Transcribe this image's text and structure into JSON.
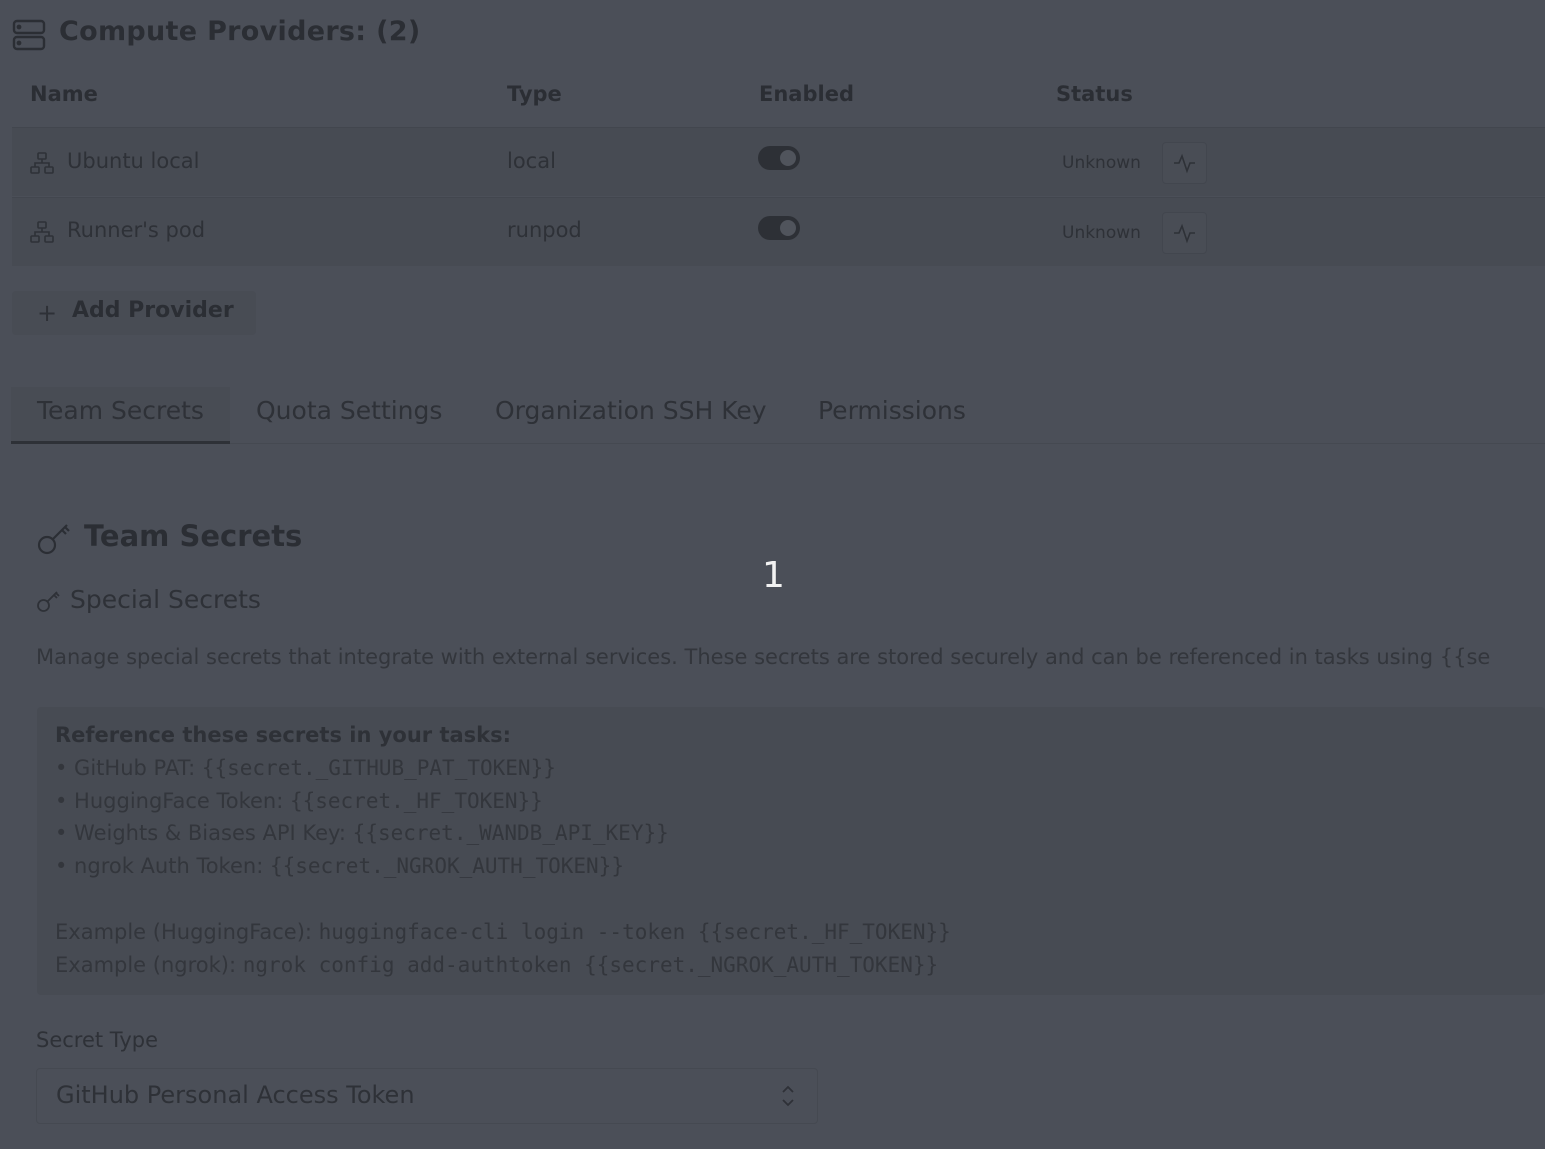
{
  "header": {
    "title": "Compute Providers: (2)",
    "icon": "server-icon"
  },
  "providers_table": {
    "columns": [
      "Name",
      "Type",
      "Enabled",
      "Status"
    ],
    "rows": [
      {
        "name": "Ubuntu local",
        "type": "local",
        "enabled": true,
        "status": "Unknown"
      },
      {
        "name": "Runner's pod",
        "type": "runpod",
        "enabled": true,
        "status": "Unknown"
      }
    ]
  },
  "add_provider": {
    "label": "Add Provider",
    "icon": "plus-icon"
  },
  "tabs": [
    {
      "label": "Team Secrets",
      "active": true
    },
    {
      "label": "Quota Settings",
      "active": false
    },
    {
      "label": "Organization SSH Key",
      "active": false
    },
    {
      "label": "Permissions",
      "active": false
    }
  ],
  "team_secrets": {
    "title": "Team Secrets",
    "subtitle": "Special Secrets",
    "description": "Manage special secrets that integrate with external services. These secrets are stored securely and can be referenced in tasks using {{se",
    "reference": {
      "heading": "Reference these secrets in your tasks:",
      "items": [
        {
          "label": "• GitHub PAT: ",
          "code": "{{secret._GITHUB_PAT_TOKEN}}"
        },
        {
          "label": "• HuggingFace Token: ",
          "code": "{{secret._HF_TOKEN}}"
        },
        {
          "label": "• Weights & Biases API Key: ",
          "code": "{{secret._WANDB_API_KEY}}"
        },
        {
          "label": "• ngrok Auth Token: ",
          "code": "{{secret._NGROK_AUTH_TOKEN}}"
        }
      ],
      "examples": [
        {
          "label": "Example (HuggingFace): ",
          "code": "huggingface-cli login --token {{secret._HF_TOKEN}}"
        },
        {
          "label": "Example (ngrok): ",
          "code": "ngrok config add-authtoken {{secret._NGROK_AUTH_TOKEN}}"
        }
      ]
    },
    "secret_type": {
      "label": "Secret Type",
      "value": "GitHub Personal Access Token"
    }
  },
  "overlay": {
    "step_badge": "1"
  },
  "colors": {
    "overlay_background": "#4b4f58",
    "badge_text": "#f2f2f2"
  }
}
